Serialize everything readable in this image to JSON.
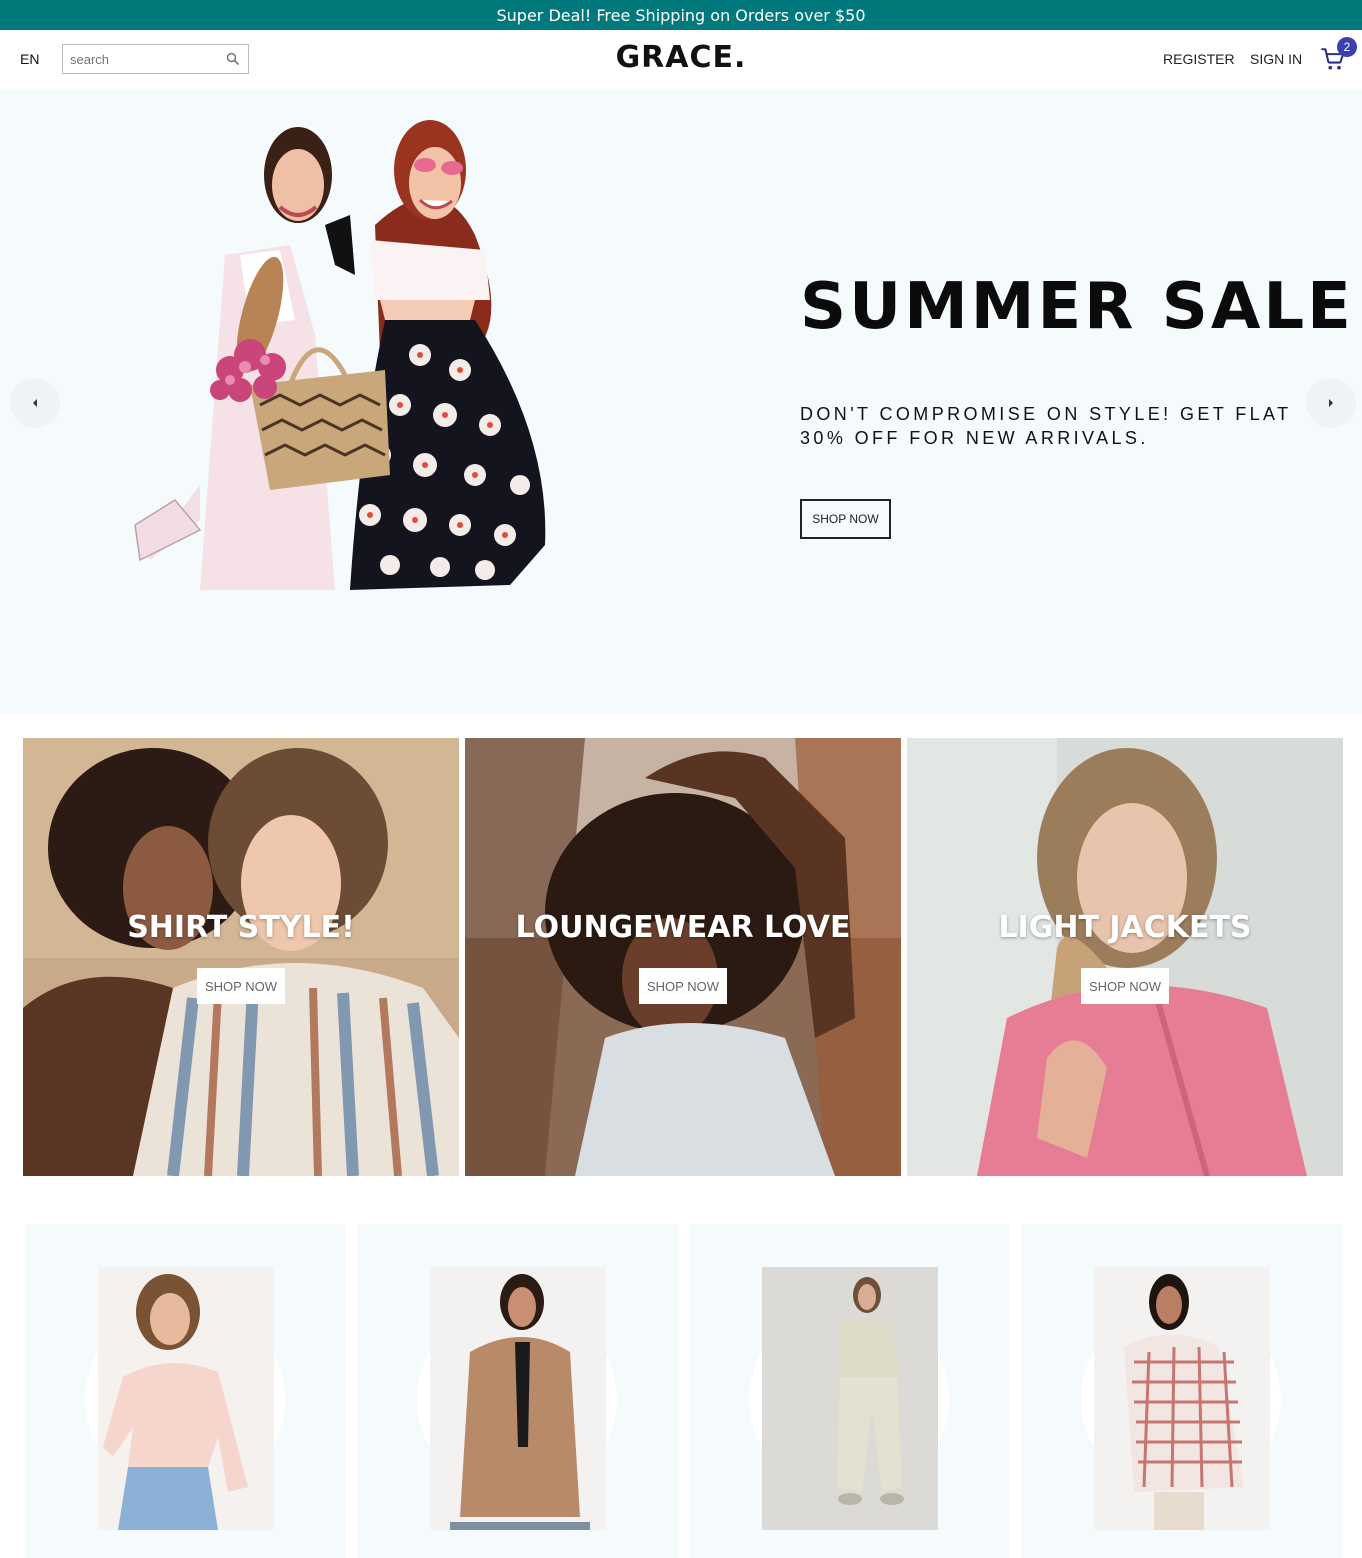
{
  "announcement": {
    "text": "Super Deal! Free Shipping on Orders over $50"
  },
  "header": {
    "language": "EN",
    "search": {
      "placeholder": "search",
      "value": ""
    },
    "logo": "GRACE.",
    "register_label": "REGISTER",
    "signin_label": "SIGN IN",
    "cart_count": "2"
  },
  "hero": {
    "title": "SUMMER SALE",
    "description": "DON'T COMPROMISE ON STYLE! GET FLAT 30% OFF FOR NEW ARRIVALS.",
    "button_label": "SHOP NOW",
    "background": "#f5fafd"
  },
  "categories": [
    {
      "title": "SHIRT STYLE!",
      "button_label": "SHOP NOW"
    },
    {
      "title": "LOUNGEWEAR LOVE",
      "button_label": "SHOP NOW"
    },
    {
      "title": "LIGHT JACKETS",
      "button_label": "SHOP NOW"
    }
  ],
  "colors": {
    "announcement_bg": "#00797c",
    "cart_badge_bg": "#3a40b0",
    "product_card_bg": "#f5fafd"
  },
  "icons": {
    "search": "search-icon",
    "cart": "shopping-cart-icon",
    "prev": "arrow-left-icon",
    "next": "arrow-right-icon"
  }
}
